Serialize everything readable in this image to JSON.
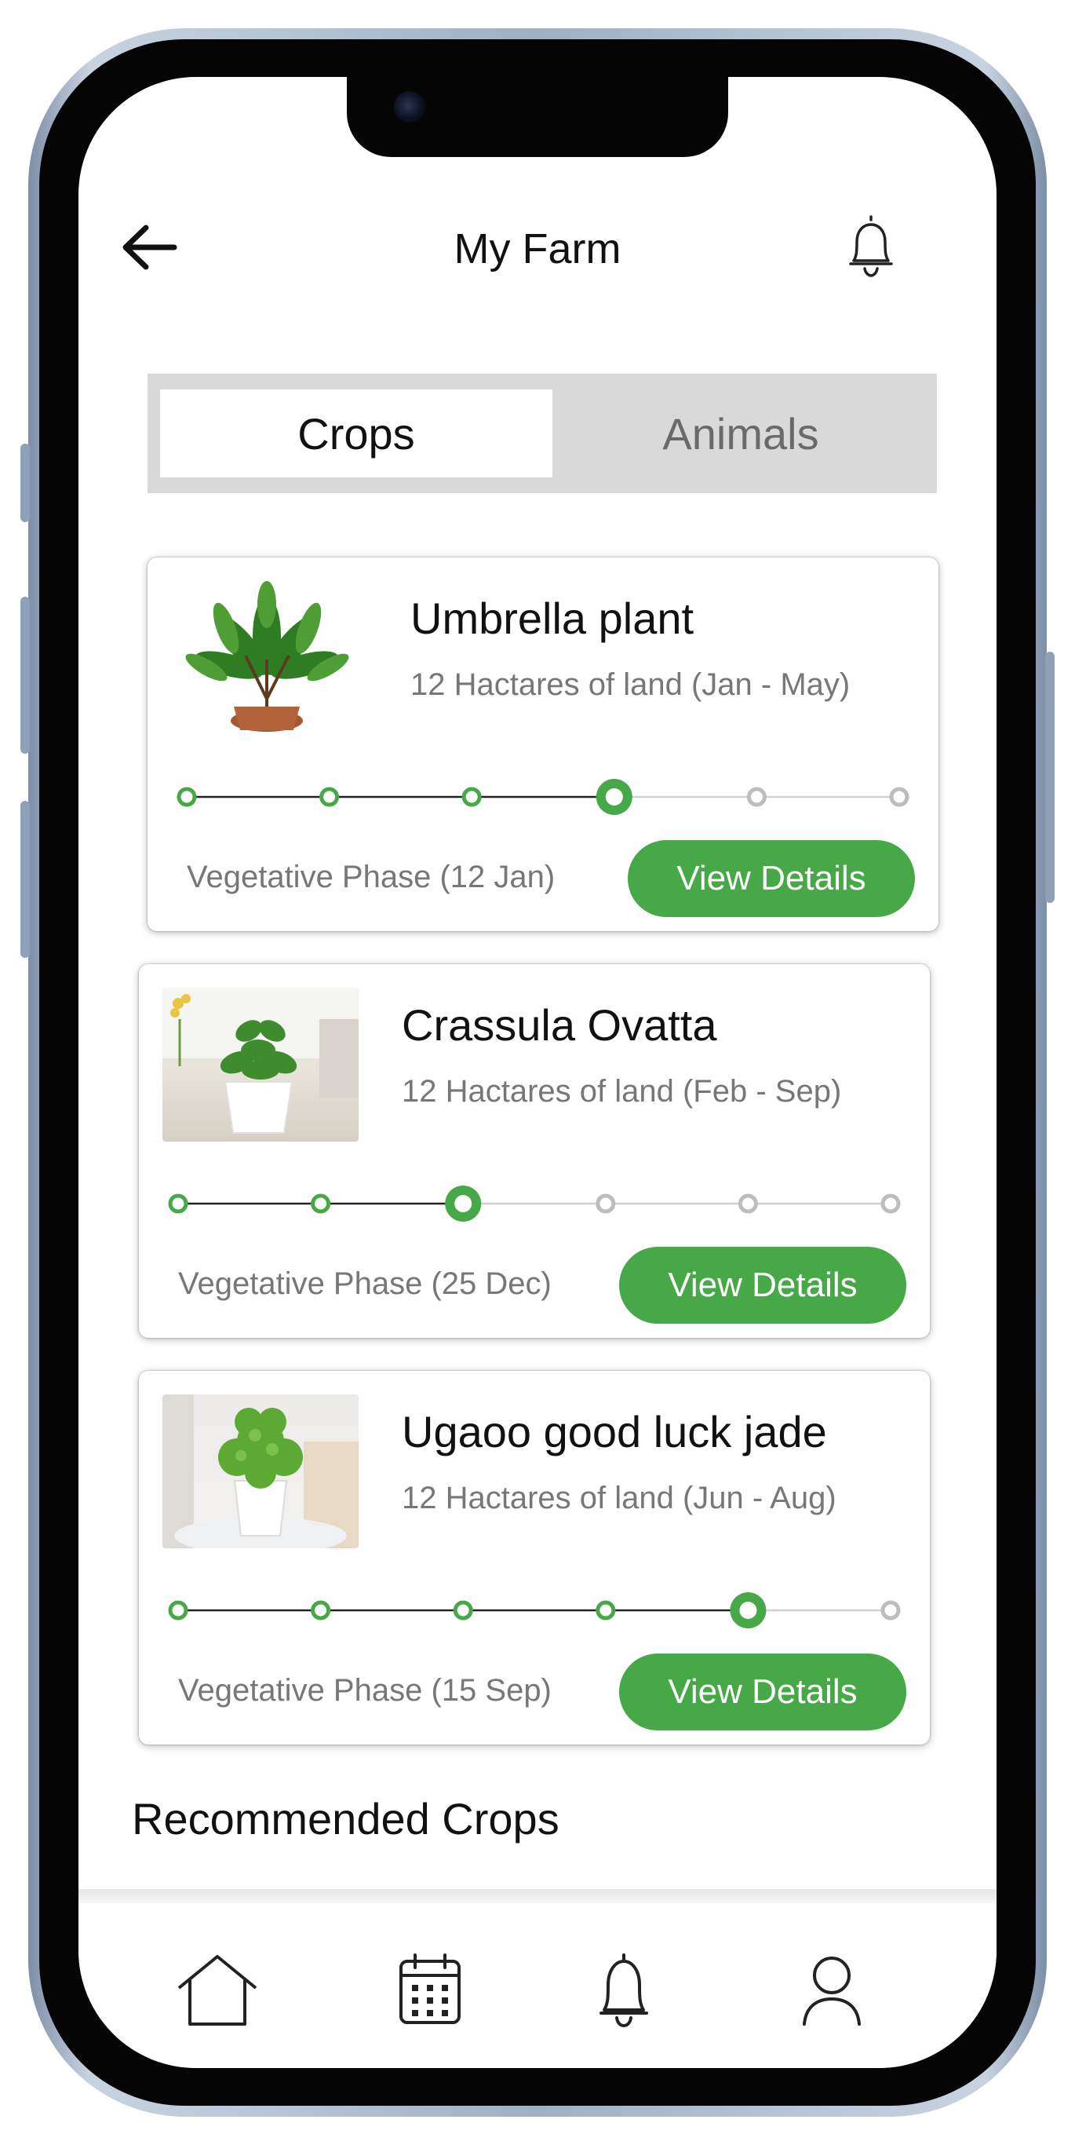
{
  "header": {
    "title": "My Farm",
    "back_icon": "arrow-left-icon",
    "notification_icon": "bell-icon"
  },
  "tabs": [
    {
      "label": "Crops",
      "active": true
    },
    {
      "label": "Animals",
      "active": false
    }
  ],
  "crops": [
    {
      "name": "Umbrella plant",
      "land": "12 Hactares of land (Jan - May)",
      "phase": "Vegetative Phase (12 Jan)",
      "button": "View Details",
      "current_step": 4,
      "total_steps": 6
    },
    {
      "name": "Crassula Ovatta",
      "land": "12 Hactares of land (Feb - Sep)",
      "phase": "Vegetative Phase (25 Dec)",
      "button": "View Details",
      "current_step": 3,
      "total_steps": 6
    },
    {
      "name": "Ugaoo good luck jade",
      "land": "12 Hactares of land (Jun - Aug)",
      "phase": "Vegetative Phase (15 Sep)",
      "button": "View Details",
      "current_step": 5,
      "total_steps": 6
    }
  ],
  "recommended": {
    "title": "Recommended Crops"
  },
  "nav": [
    {
      "icon": "home-icon"
    },
    {
      "icon": "calendar-icon"
    },
    {
      "icon": "bell-icon"
    },
    {
      "icon": "user-icon"
    }
  ],
  "colors": {
    "accent": "#46a847",
    "inactive": "#bdbdbd",
    "line_done": "#222222"
  }
}
